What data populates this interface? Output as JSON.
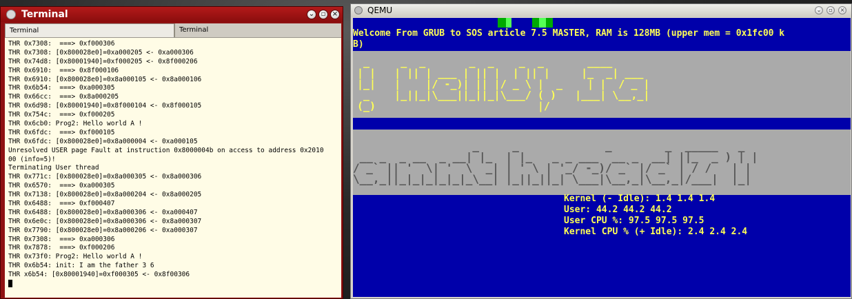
{
  "terminal": {
    "title": "Terminal",
    "tabs": [
      "Terminal",
      "Terminal"
    ],
    "lines": [
      "THR 0x7308:  ===> 0xf000306",
      "THR 0x7308: [0x800028e0]=0xa000205 <- 0xa000306",
      "THR 0x74d8: [0x80001940]=0xf000205 <- 0x8f000206",
      "THR 0x6910:  ===> 0x8f000106",
      "THR 0x6910: [0x800028e0]=0x8a000105 <- 0x8a000106",
      "THR 0x6b54:  ===> 0xa000305",
      "THR 0x66cc:  ===> 0x8a000205",
      "THR 0x6d98: [0x80001940]=0x8f000104 <- 0x8f000105",
      "THR 0x754c:  ===> 0xf000205",
      "THR 0x6cb0: Prog2: Hello world A !",
      "THR 0x6fdc:  ===> 0xf000105",
      "THR 0x6fdc: [0x800028e0]=0x8a000004 <- 0xa000105",
      "Unresolved USER page Fault at instruction 0x8000004b on access to address 0x2010",
      "00 (info=5)!",
      "Terminating User thread",
      "THR 0x771c: [0x800028e0]=0x8a000305 <- 0x8a000306",
      "THR 0x6570:  ===> 0xa000305",
      "THR 0x7138: [0x800028e0]=0x8a000204 <- 0x8a000205",
      "THR 0x6488:  ===> 0xf000407",
      "THR 0x6488: [0x800028e0]=0x8a000306 <- 0xa000407",
      "THR 0x6e0c: [0x800028e0]=0x8a000306 <- 0x8a000307",
      "THR 0x7790: [0x800028e0]=0x8a000206 <- 0xa000307",
      "THR 0x7308:  ===> 0xa000306",
      "THR 0x7878:  ===> 0xf000206",
      "THR 0x73f0: Prog2: Hello world A !",
      "THR 0x6b54: init: I am the father 3 6",
      "THR x6b54: [0x80001940]=0xf000305 <- 0x8f00306"
    ]
  },
  "qemu": {
    "title": "QEMU",
    "welcome_line1": "Welcome From GRUB to SOS article 7.5 MASTER, RAM is 128MB (upper mem = 0x1fc00 k",
    "welcome_line2": "B)",
    "banner1": [
      " _     _  _       _  _    _  _       ____  ",
      "| |   | || | ___ | || |  | || |     |_  _| ___ ",
      "|_|   |    |/ -_)| || |/ _ \\ |  _    | |  / _ |",
      " _    |_||_|\\___||_||_|\\___/ ( )   |___| \\__,_|",
      "(_)                          |/              "
    ],
    "banner2": [
      "                  _     _             _        _  _____   _ ",
      " __ _  _ __  _ __| |_  | |_   _ _ ___  __ _  __| ||_  _ ) | |",
      "/ _` || '  \\| '  \\  _| | ' \\ | '_/ -_)/ _` |/ _` | / /   | |",
      "\\__,_||_|_|_|_|_|_\\__| |_||_||_| \\___|\\__,_|\\__,_|/___|  |_|"
    ],
    "stats": [
      "Kernel (- Idle): 1.4 1.4 1.4",
      "User: 44.2 44.2 44.2",
      "User CPU %: 97.5 97.5 97.5",
      "Kernel CPU % (+ Idle): 2.4 2.4 2.4"
    ]
  }
}
